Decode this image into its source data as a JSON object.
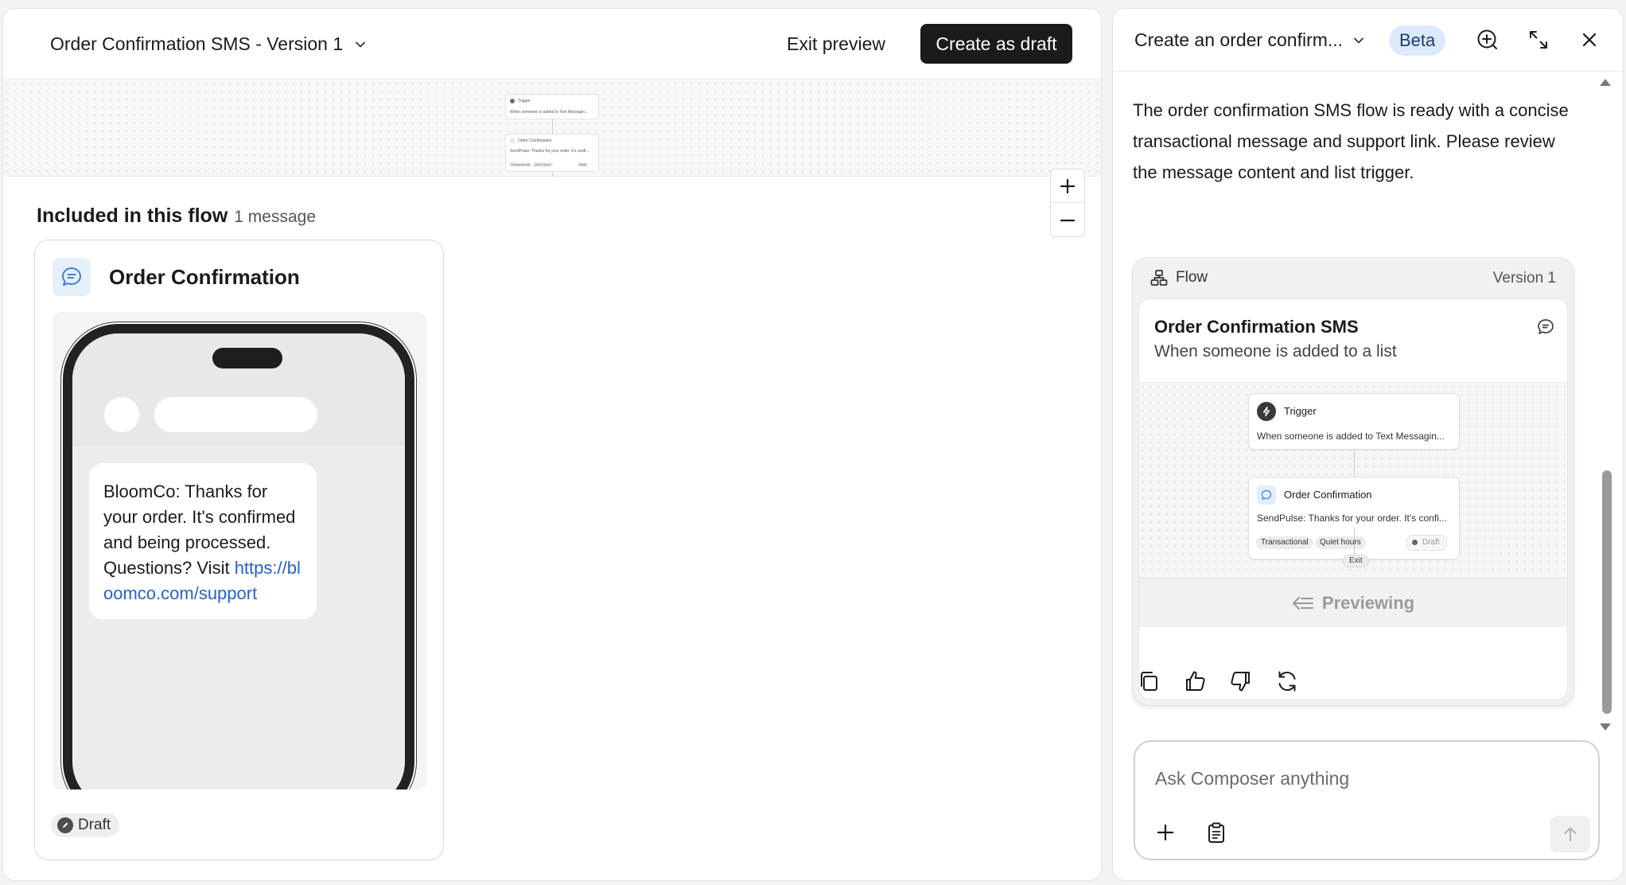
{
  "left": {
    "flow_title": "Order Confirmation SMS - Version 1",
    "exit_preview": "Exit preview",
    "create_draft": "Create as draft",
    "mini_canvas": {
      "trigger_label": "Trigger",
      "trigger_desc": "When someone is added to Text Messagin...",
      "message_label": "Order Confirmation",
      "message_desc": "SendPulse: Thanks for your order. It's confi...",
      "chip1": "Transactional",
      "chip2": "Quiet hours",
      "status": "Draft"
    },
    "included_title": "Included in this flow",
    "included_count": "1 message",
    "message_card": {
      "title": "Order Confirmation",
      "sms_text": "BloomCo: Thanks for your order. It's confirmed and being processed. Questions? Visit ",
      "sms_link": "https://bloomco.com/support",
      "status": "Draft"
    }
  },
  "right": {
    "chat_title": "Create an order confirm...",
    "beta": "Beta",
    "assistant_message": "The order confirmation SMS flow is ready with a concise transactional message and support link. Please review the message content and list trigger.",
    "flow_card": {
      "label": "Flow",
      "version": "Version 1",
      "title": "Order Confirmation SMS",
      "subtitle": "When someone is added to a list",
      "trigger_title": "Trigger",
      "trigger_desc": "When someone is added to Text Messagin...",
      "message_title": "Order Confirmation",
      "message_desc": "SendPulse: Thanks for your order. It's confi...",
      "chip1": "Transactional",
      "chip2": "Quiet hours",
      "status": "Draft",
      "exit": "Exit",
      "previewing": "Previewing"
    },
    "composer_placeholder": "Ask Composer anything"
  },
  "colors": {
    "primary_button": "#1b1b1b",
    "link": "#2563c9",
    "beta_bg": "#dbeafe"
  }
}
